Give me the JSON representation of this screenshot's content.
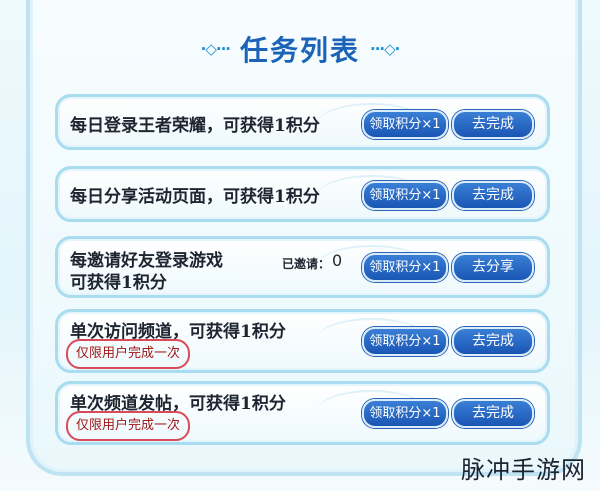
{
  "header": {
    "title": "任务列表",
    "left_ornament": "·◇···",
    "right_ornament": "···◇·"
  },
  "tasks": [
    {
      "text": "每日登录王者荣耀，可获得1积分",
      "claim_label": "领取积分×1",
      "action_label": "去完成"
    },
    {
      "text": "每日分享活动页面，可获得1积分",
      "claim_label": "领取积分×1",
      "action_label": "去完成"
    },
    {
      "text_line1": "每邀请好友登录游戏",
      "text_line2": "可获得1积分",
      "invited_label": "已邀请：",
      "invited_count": "0",
      "claim_label": "领取积分×1",
      "action_label": "去分享"
    },
    {
      "text": "单次访问频道，可获得1积分",
      "note": "仅限用户完成一次",
      "claim_label": "领取积分×1",
      "action_label": "去完成"
    },
    {
      "text": "单次频道发帖，可获得1积分",
      "note": "仅限用户完成一次",
      "claim_label": "领取积分×1",
      "action_label": "去完成"
    }
  ],
  "watermark": "脉冲手游网",
  "colors": {
    "button_blue": "#1f5fbf",
    "title_blue": "#1a63b8",
    "note_red": "#d94a5a",
    "card_border": "#a9dcef"
  }
}
